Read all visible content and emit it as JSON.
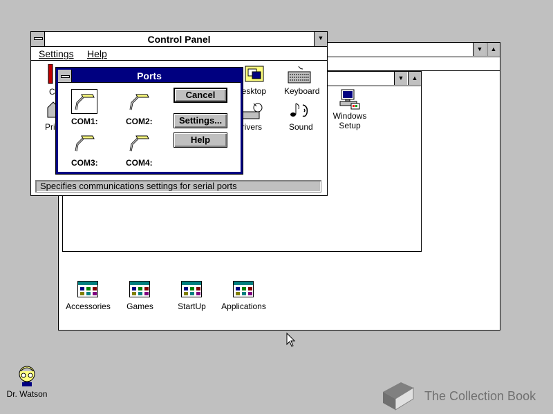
{
  "program_manager": {
    "groups": [
      {
        "label": "Accessories"
      },
      {
        "label": "Games"
      },
      {
        "label": "StartUp"
      },
      {
        "label": "Applications"
      }
    ]
  },
  "inner_window": {
    "icons": [
      {
        "label_line1": "Windows",
        "label_line2": "Setup"
      }
    ]
  },
  "control_panel": {
    "title": "Control Panel",
    "menu": {
      "settings": "Settings",
      "help": "Help"
    },
    "icons": {
      "desktop": "Desktop",
      "keyboard": "Keyboard",
      "drivers": "Drivers",
      "sound": "Sound",
      "partial_left1": "C",
      "partial_left2": "Prin"
    },
    "status": "Specifies communications settings for serial ports"
  },
  "ports_dialog": {
    "title": "Ports",
    "ports": [
      {
        "label": "COM1:"
      },
      {
        "label": "COM2:"
      },
      {
        "label": "COM3:"
      },
      {
        "label": "COM4:"
      }
    ],
    "buttons": {
      "cancel": "Cancel",
      "settings": "Settings...",
      "help": "Help"
    }
  },
  "desktop": {
    "dr_watson": "Dr. Watson",
    "watermark": "The Collection Book"
  }
}
